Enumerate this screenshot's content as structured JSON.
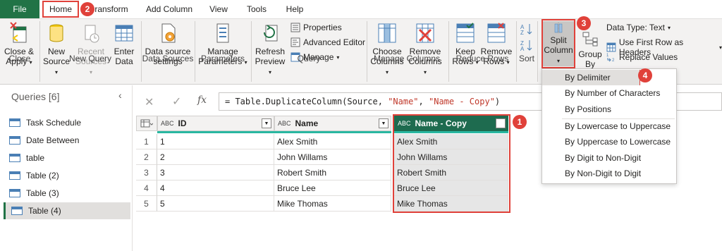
{
  "tabs": {
    "file": "File",
    "home": "Home",
    "transform": "ransform",
    "add_column": "Add Column",
    "view": "View",
    "tools": "Tools",
    "help": "Help"
  },
  "ribbon": {
    "close_apply": [
      "Close &",
      "Apply"
    ],
    "new_source": [
      "New",
      "Source"
    ],
    "recent_sources": [
      "Recent",
      "Sources"
    ],
    "enter_data": [
      "Enter",
      "Data"
    ],
    "data_source_settings": [
      "Data source",
      "settings"
    ],
    "manage_parameters": [
      "Manage",
      "Parameters"
    ],
    "refresh_preview": [
      "Refresh",
      "Preview"
    ],
    "properties": "Properties",
    "advanced_editor": "Advanced Editor",
    "manage": "Manage",
    "choose_columns": [
      "Choose",
      "Columns"
    ],
    "remove_columns": [
      "Remove",
      "Columns"
    ],
    "keep_rows": [
      "Keep",
      "Rows"
    ],
    "remove_rows": [
      "Remove",
      "Rows"
    ],
    "split_column": [
      "Split",
      "Column"
    ],
    "group_by": [
      "Group",
      "By"
    ],
    "data_type": "Data Type: Text",
    "first_row_headers": "Use First Row as Headers",
    "replace_values": "Replace Values",
    "groups": {
      "close": "Close",
      "new_query": "New Query",
      "data_sources": "Data Sources",
      "parameters": "Parameters",
      "query": "Query",
      "manage_columns": "Manage Columns",
      "reduce_rows": "Reduce Rows",
      "sort": "Sort"
    }
  },
  "queries": {
    "title": "Queries [6]",
    "items": [
      "Task Schedule",
      "Date Between",
      "table",
      "Table (2)",
      "Table (3)",
      "Table (4)"
    ],
    "selected_index": 5
  },
  "formula": {
    "text": "= Table.DuplicateColumn(Source, \"Name\", \"Name - Copy\")",
    "fx": "fx"
  },
  "table": {
    "type_label": "ABC",
    "columns": [
      "ID",
      "Name",
      "Name - Copy"
    ],
    "rows": [
      [
        "1",
        "Alex Smith",
        "Alex Smith"
      ],
      [
        "2",
        "John Willams",
        "John Willams"
      ],
      [
        "3",
        "Robert Smith",
        "Robert Smith"
      ],
      [
        "4",
        "Bruce Lee",
        "Bruce Lee"
      ],
      [
        "5",
        "Mike Thomas",
        "Mike Thomas"
      ]
    ],
    "row_numbers": [
      "1",
      "2",
      "3",
      "4",
      "5"
    ]
  },
  "split_menu": {
    "items": [
      "By Delimiter",
      "By Number of Characters",
      "By Positions",
      "By Lowercase to Uppercase",
      "By Uppercase to Lowercase",
      "By Digit to Non-Digit",
      "By Non-Digit to Digit"
    ]
  },
  "badges": [
    "1",
    "2",
    "3",
    "4"
  ],
  "colors": {
    "file_tab": "#217346",
    "selected_column_header": "#1e6b4f",
    "annotation_red": "#e0413a",
    "selected_column_bg": "#e6e6e6"
  }
}
